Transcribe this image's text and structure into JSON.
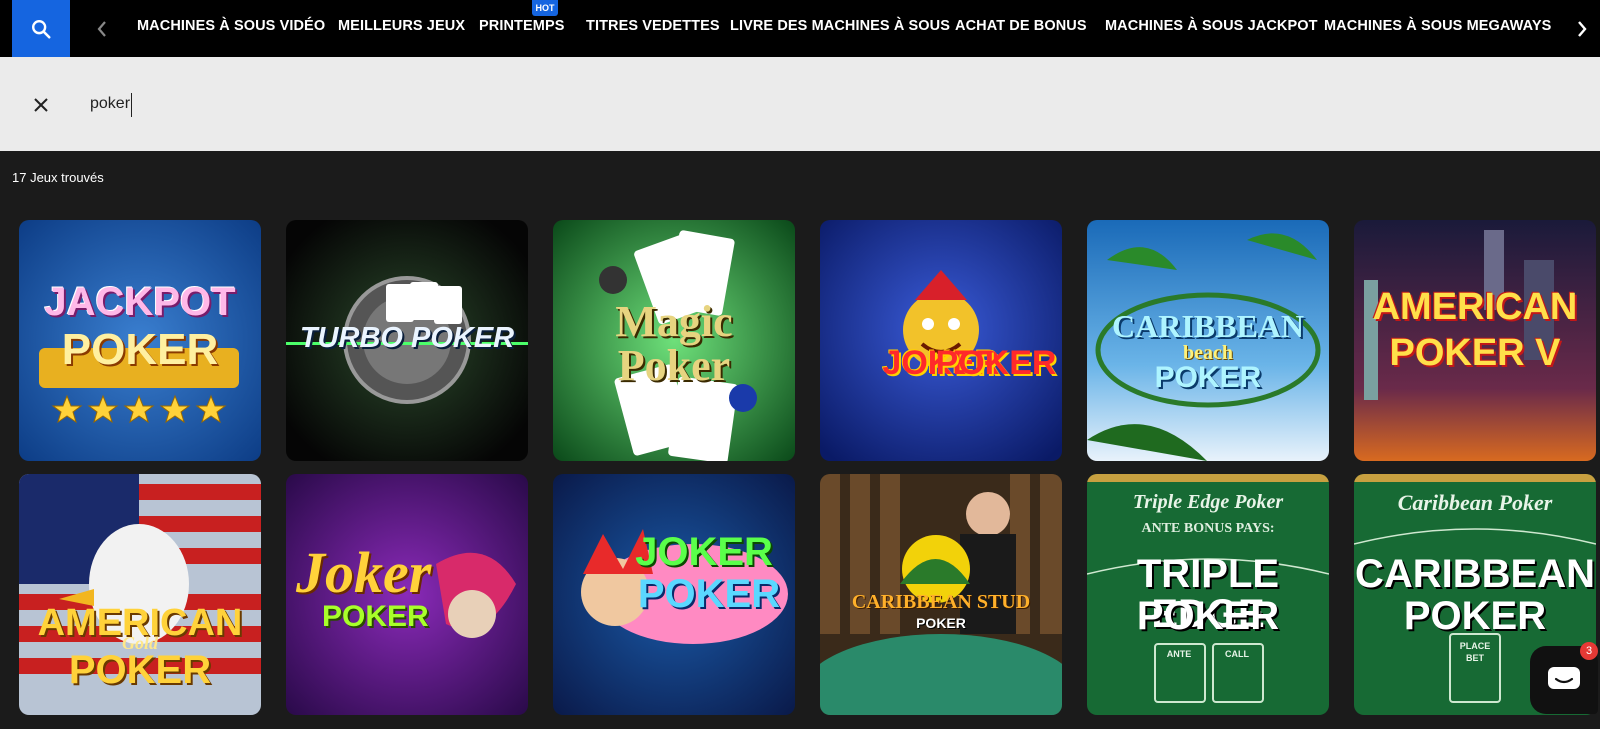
{
  "nav": {
    "items": [
      "MACHINES À SOUS VIDÉO",
      "MEILLEURS JEUX",
      "PRINTEMPS",
      "TITRES VEDETTES",
      "LIVRE DES MACHINES À SOUS",
      "ACHAT DE BONUS",
      "MACHINES À SOUS JACKPOT",
      "MACHINES À SOUS MEGAWAYS"
    ],
    "hot_badge": "HOT",
    "accent": "#1565e0"
  },
  "search": {
    "value": "poker"
  },
  "results": {
    "count_label": "17 Jeux trouvés"
  },
  "games": [
    {
      "l1": "JACKPOT",
      "l2": "POKER",
      "l3": ""
    },
    {
      "l1": "TURBO POKER",
      "l2": "",
      "l3": ""
    },
    {
      "l1": "Magic",
      "l2": "Poker",
      "l3": ""
    },
    {
      "l1": "JOKER",
      "l2": "POKER",
      "l3": ""
    },
    {
      "l1": "CARIBBEAN",
      "l2": "beach",
      "l3": "POKER"
    },
    {
      "l1": "AMERICAN",
      "l2": "POKER V",
      "l3": ""
    },
    {
      "l1": "AMERICAN",
      "l2": "Gold",
      "l3": "POKER"
    },
    {
      "l1": "Joker",
      "l2": "POKER",
      "l3": ""
    },
    {
      "l1": "JOKER",
      "l2": "POKER",
      "l3": ""
    },
    {
      "l1": "CARIBBEAN STUD",
      "l2": "POKER",
      "l3": ""
    },
    {
      "l1": "Triple Edge Poker",
      "l2": "ANTE BONUS PAYS:",
      "l3": "TRIPLE EDGE",
      "l4": "POKER",
      "l5": "ANTE",
      "l6": "CALL"
    },
    {
      "l1": "Caribbean Poker",
      "l2": "CARIBBEAN",
      "l3": "POKER",
      "l4": "PLACE",
      "l5": "BET"
    }
  ],
  "chat": {
    "badge": "3"
  }
}
